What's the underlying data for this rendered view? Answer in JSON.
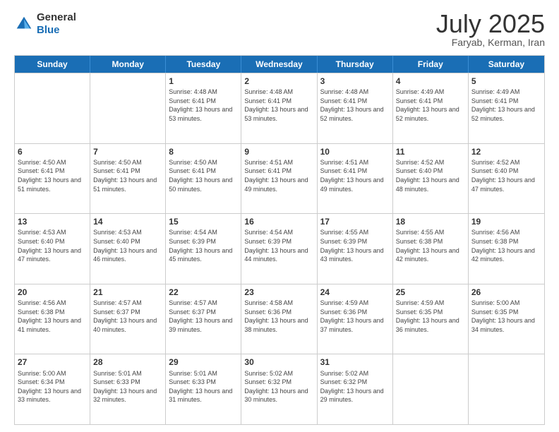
{
  "header": {
    "logo_line1": "General",
    "logo_line2": "Blue",
    "title": "July 2025",
    "location": "Faryab, Kerman, Iran"
  },
  "days_of_week": [
    "Sunday",
    "Monday",
    "Tuesday",
    "Wednesday",
    "Thursday",
    "Friday",
    "Saturday"
  ],
  "weeks": [
    [
      {
        "day": "",
        "sunrise": "",
        "sunset": "",
        "daylight": ""
      },
      {
        "day": "",
        "sunrise": "",
        "sunset": "",
        "daylight": ""
      },
      {
        "day": "1",
        "sunrise": "Sunrise: 4:48 AM",
        "sunset": "Sunset: 6:41 PM",
        "daylight": "Daylight: 13 hours and 53 minutes."
      },
      {
        "day": "2",
        "sunrise": "Sunrise: 4:48 AM",
        "sunset": "Sunset: 6:41 PM",
        "daylight": "Daylight: 13 hours and 53 minutes."
      },
      {
        "day": "3",
        "sunrise": "Sunrise: 4:48 AM",
        "sunset": "Sunset: 6:41 PM",
        "daylight": "Daylight: 13 hours and 52 minutes."
      },
      {
        "day": "4",
        "sunrise": "Sunrise: 4:49 AM",
        "sunset": "Sunset: 6:41 PM",
        "daylight": "Daylight: 13 hours and 52 minutes."
      },
      {
        "day": "5",
        "sunrise": "Sunrise: 4:49 AM",
        "sunset": "Sunset: 6:41 PM",
        "daylight": "Daylight: 13 hours and 52 minutes."
      }
    ],
    [
      {
        "day": "6",
        "sunrise": "Sunrise: 4:50 AM",
        "sunset": "Sunset: 6:41 PM",
        "daylight": "Daylight: 13 hours and 51 minutes."
      },
      {
        "day": "7",
        "sunrise": "Sunrise: 4:50 AM",
        "sunset": "Sunset: 6:41 PM",
        "daylight": "Daylight: 13 hours and 51 minutes."
      },
      {
        "day": "8",
        "sunrise": "Sunrise: 4:50 AM",
        "sunset": "Sunset: 6:41 PM",
        "daylight": "Daylight: 13 hours and 50 minutes."
      },
      {
        "day": "9",
        "sunrise": "Sunrise: 4:51 AM",
        "sunset": "Sunset: 6:41 PM",
        "daylight": "Daylight: 13 hours and 49 minutes."
      },
      {
        "day": "10",
        "sunrise": "Sunrise: 4:51 AM",
        "sunset": "Sunset: 6:41 PM",
        "daylight": "Daylight: 13 hours and 49 minutes."
      },
      {
        "day": "11",
        "sunrise": "Sunrise: 4:52 AM",
        "sunset": "Sunset: 6:40 PM",
        "daylight": "Daylight: 13 hours and 48 minutes."
      },
      {
        "day": "12",
        "sunrise": "Sunrise: 4:52 AM",
        "sunset": "Sunset: 6:40 PM",
        "daylight": "Daylight: 13 hours and 47 minutes."
      }
    ],
    [
      {
        "day": "13",
        "sunrise": "Sunrise: 4:53 AM",
        "sunset": "Sunset: 6:40 PM",
        "daylight": "Daylight: 13 hours and 47 minutes."
      },
      {
        "day": "14",
        "sunrise": "Sunrise: 4:53 AM",
        "sunset": "Sunset: 6:40 PM",
        "daylight": "Daylight: 13 hours and 46 minutes."
      },
      {
        "day": "15",
        "sunrise": "Sunrise: 4:54 AM",
        "sunset": "Sunset: 6:39 PM",
        "daylight": "Daylight: 13 hours and 45 minutes."
      },
      {
        "day": "16",
        "sunrise": "Sunrise: 4:54 AM",
        "sunset": "Sunset: 6:39 PM",
        "daylight": "Daylight: 13 hours and 44 minutes."
      },
      {
        "day": "17",
        "sunrise": "Sunrise: 4:55 AM",
        "sunset": "Sunset: 6:39 PM",
        "daylight": "Daylight: 13 hours and 43 minutes."
      },
      {
        "day": "18",
        "sunrise": "Sunrise: 4:55 AM",
        "sunset": "Sunset: 6:38 PM",
        "daylight": "Daylight: 13 hours and 42 minutes."
      },
      {
        "day": "19",
        "sunrise": "Sunrise: 4:56 AM",
        "sunset": "Sunset: 6:38 PM",
        "daylight": "Daylight: 13 hours and 42 minutes."
      }
    ],
    [
      {
        "day": "20",
        "sunrise": "Sunrise: 4:56 AM",
        "sunset": "Sunset: 6:38 PM",
        "daylight": "Daylight: 13 hours and 41 minutes."
      },
      {
        "day": "21",
        "sunrise": "Sunrise: 4:57 AM",
        "sunset": "Sunset: 6:37 PM",
        "daylight": "Daylight: 13 hours and 40 minutes."
      },
      {
        "day": "22",
        "sunrise": "Sunrise: 4:57 AM",
        "sunset": "Sunset: 6:37 PM",
        "daylight": "Daylight: 13 hours and 39 minutes."
      },
      {
        "day": "23",
        "sunrise": "Sunrise: 4:58 AM",
        "sunset": "Sunset: 6:36 PM",
        "daylight": "Daylight: 13 hours and 38 minutes."
      },
      {
        "day": "24",
        "sunrise": "Sunrise: 4:59 AM",
        "sunset": "Sunset: 6:36 PM",
        "daylight": "Daylight: 13 hours and 37 minutes."
      },
      {
        "day": "25",
        "sunrise": "Sunrise: 4:59 AM",
        "sunset": "Sunset: 6:35 PM",
        "daylight": "Daylight: 13 hours and 36 minutes."
      },
      {
        "day": "26",
        "sunrise": "Sunrise: 5:00 AM",
        "sunset": "Sunset: 6:35 PM",
        "daylight": "Daylight: 13 hours and 34 minutes."
      }
    ],
    [
      {
        "day": "27",
        "sunrise": "Sunrise: 5:00 AM",
        "sunset": "Sunset: 6:34 PM",
        "daylight": "Daylight: 13 hours and 33 minutes."
      },
      {
        "day": "28",
        "sunrise": "Sunrise: 5:01 AM",
        "sunset": "Sunset: 6:33 PM",
        "daylight": "Daylight: 13 hours and 32 minutes."
      },
      {
        "day": "29",
        "sunrise": "Sunrise: 5:01 AM",
        "sunset": "Sunset: 6:33 PM",
        "daylight": "Daylight: 13 hours and 31 minutes."
      },
      {
        "day": "30",
        "sunrise": "Sunrise: 5:02 AM",
        "sunset": "Sunset: 6:32 PM",
        "daylight": "Daylight: 13 hours and 30 minutes."
      },
      {
        "day": "31",
        "sunrise": "Sunrise: 5:02 AM",
        "sunset": "Sunset: 6:32 PM",
        "daylight": "Daylight: 13 hours and 29 minutes."
      },
      {
        "day": "",
        "sunrise": "",
        "sunset": "",
        "daylight": ""
      },
      {
        "day": "",
        "sunrise": "",
        "sunset": "",
        "daylight": ""
      }
    ]
  ]
}
